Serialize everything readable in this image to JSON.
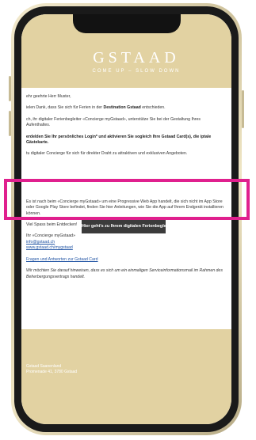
{
  "email": {
    "logo_main": "GSTAAD",
    "logo_sub": "COME UP – SLOW DOWN",
    "greeting": "ehr geehrte Herr Muster,",
    "p1_prefix": "ielen Dank, dass Sie sich für Ferien in der ",
    "p1_bold": "Destination Gstaad",
    "p1_suffix": " entschieden.",
    "p2": "ch, ihr digitaler Ferienbegleiter «Concierge myGstaad», unterstütze Sie bei der Gestaltung Ihres Aufenthaltes.",
    "p3_bold": "erdelden Sie Ihr persönliches Login* und aktivieren Sie sogleich Ihre Gstaad Card(s), die iptale Gästekarte.",
    "p4": "tu digitaler Concierge für sich für direkter Draht zu attraktiven und exklusiven Angeboten.",
    "cta": "Hier geht's zu Ihrem digitalen Ferienbegleiter",
    "p5": "Es ist nach beim «Concierge myGstaad» um eine Progressive Web App handelt, die sich nicht im App Store oder Google Play Store befindet, finden Sie hier Anleitungen, wie Sie die App auf Ihrem Endgerät installieren können.",
    "p6": "Viel Spass beim Entdecken!",
    "sig1": "Ihr «Concierge myGstaad»",
    "sig_link1": "info@gstaad.ch",
    "sig_link2": "www.gstaad.ch/mygstaad",
    "faq": "Fragen und Antworten zur Gstaad Card",
    "disclaimer": "Wir möchten Sie darauf hinweisen, dass es sich um ein einmaligen Serviceinformationsmail im Rahmen des Beherbergungsvertrags handelt.",
    "footer_line1": "Gstaad Saanenland",
    "footer_line2": "Promenade 41, 3780 Gstaad"
  }
}
